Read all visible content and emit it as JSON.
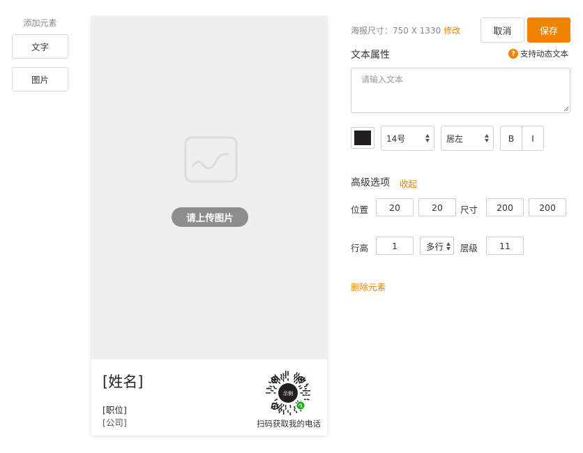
{
  "toolbox": {
    "title": "添加元素",
    "buttons": [
      "文字",
      "图片"
    ]
  },
  "poster": {
    "upload_label": "请上传图片",
    "name": "[姓名]",
    "position": "[职位]",
    "company": "[公司]",
    "qr_center_text": "示例",
    "qr_caption": "扫码获取我的电话"
  },
  "header": {
    "size_label": "海报尺寸：750 X 1330",
    "size_edit": "修改",
    "cancel": "取消",
    "save": "保存"
  },
  "text_props": {
    "title": "文本属性",
    "dynamic_text": "支持动态文本",
    "help_icon_glyph": "?",
    "placeholder": "请输入文本",
    "color": "#231f20",
    "font_size": "14号",
    "align": "居左",
    "bold": "B",
    "italic": "I"
  },
  "advanced": {
    "title": "高级选项",
    "collapse": "收起",
    "position_label": "位置",
    "x": "20",
    "y": "20",
    "size_label": "尺寸",
    "width": "200",
    "height": "200",
    "line_height_label": "行高",
    "line_height": "1",
    "line_mode": "多行",
    "layer_label": "层级",
    "layer": "11",
    "delete": "删除元素"
  },
  "colors": {
    "accent": "#f08300",
    "link": "#e8850c"
  }
}
